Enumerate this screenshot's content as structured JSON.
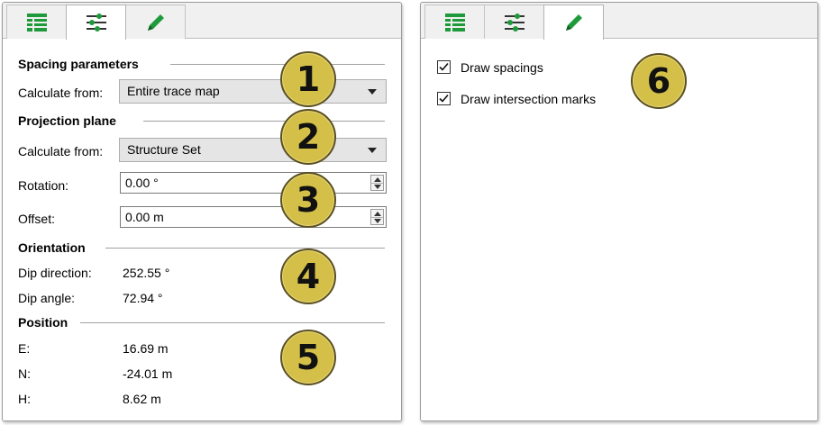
{
  "left_panel": {
    "spacing": {
      "title": "Spacing parameters",
      "calc_label": "Calculate from:",
      "calc_value": "Entire trace map"
    },
    "projection": {
      "title": "Projection plane",
      "calc_label": "Calculate from:",
      "calc_value": "Structure Set",
      "rotation_label": "Rotation:",
      "rotation_value": "0.00 °",
      "offset_label": "Offset:",
      "offset_value": "0.00 m"
    },
    "orientation": {
      "title": "Orientation",
      "dip_direction_label": "Dip direction:",
      "dip_direction_value": "252.55 °",
      "dip_angle_label": "Dip angle:",
      "dip_angle_value": "72.94 °"
    },
    "position": {
      "title": "Position",
      "e_label": "E:",
      "e_value": "16.69 m",
      "n_label": "N:",
      "n_value": "-24.01 m",
      "h_label": "H:",
      "h_value": "8.62 m"
    }
  },
  "right_panel": {
    "draw_spacings_label": "Draw spacings",
    "draw_spacings_checked": true,
    "draw_intersection_label": "Draw intersection marks",
    "draw_intersection_checked": true
  },
  "tabs": {
    "icons": [
      "list-icon",
      "sliders-icon",
      "pencil-icon"
    ],
    "left_active": "sliders-icon",
    "right_active": "pencil-icon"
  },
  "badges": [
    "1",
    "2",
    "3",
    "4",
    "5",
    "6"
  ],
  "colors": {
    "icon_green": "#1f9a3a",
    "badge_fill": "#d4bf49",
    "badge_border": "#5a5025"
  }
}
